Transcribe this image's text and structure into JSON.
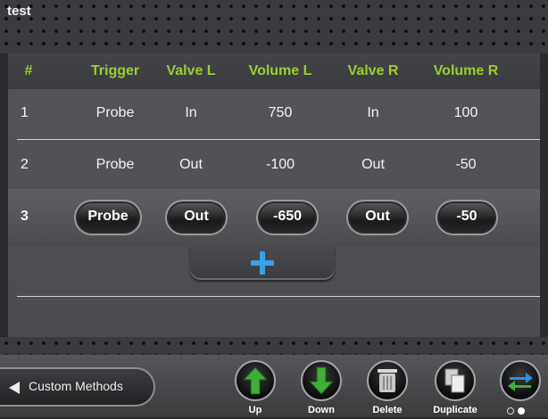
{
  "window": {
    "title": "test"
  },
  "table": {
    "headers": [
      "#",
      "Trigger",
      "Valve L",
      "Volume L",
      "Valve R",
      "Volume R"
    ],
    "rows": [
      [
        "1",
        "Probe",
        "In",
        "750",
        "In",
        "100"
      ],
      [
        "2",
        "Probe",
        "Out",
        "-100",
        "Out",
        "-50"
      ],
      [
        "3",
        "Probe",
        "Out",
        "-650",
        "Out",
        "-50"
      ]
    ],
    "selected_row": 3
  },
  "toolbar": {
    "back_label": "Custom Methods",
    "up_label": "Up",
    "down_label": "Down",
    "delete_label": "Delete",
    "duplicate_label": "Duplicate"
  },
  "icons": {
    "add": "plus-icon",
    "up": "arrow-up-icon",
    "down": "arrow-down-icon",
    "delete": "trash-icon",
    "duplicate": "copy-icon",
    "swap": "swap-icon",
    "back": "back-arrow-icon"
  },
  "pagination": {
    "pages": 2,
    "current": 2
  },
  "colors": {
    "header_text": "#9acd32",
    "arrow_green": "#3fae3a",
    "add_blue": "#3aa0e8",
    "swap_blue": "#2e8fd8"
  }
}
